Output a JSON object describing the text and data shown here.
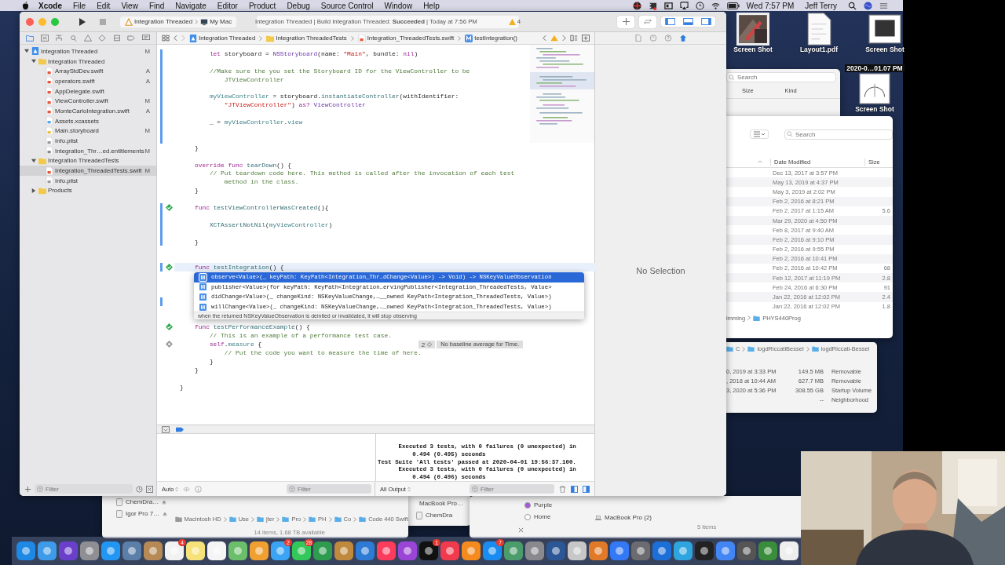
{
  "menubar": {
    "app": "Xcode",
    "menus": [
      "File",
      "Edit",
      "View",
      "Find",
      "Navigate",
      "Editor",
      "Product",
      "Debug",
      "Source Control",
      "Window",
      "Help"
    ],
    "clock": "Wed 7:57 PM",
    "user": "Jeff Terry"
  },
  "desktop_icons": [
    {
      "label": "Screen Shot"
    },
    {
      "label": "Layout1.pdf",
      "kind": "document"
    },
    {
      "label": "Screen Shot",
      "kind": "window"
    }
  ],
  "desktop_icon_extra": {
    "label": "Screen Shot",
    "sublabel": "2020-0…01.07 PM"
  },
  "finder_a": {
    "search_placeholder": "Search",
    "columns": [
      "Size",
      "Kind"
    ]
  },
  "finder_b": {
    "search_placeholder": "Search",
    "columns": [
      "Date Modified",
      "Size"
    ],
    "rows": [
      {
        "date": "Dec 13, 2017 at 3:57 PM"
      },
      {
        "date": "May 13, 2019 at 4:37 PM"
      },
      {
        "date": "May 3, 2019 at 2:02 PM"
      },
      {
        "date": "Feb 2, 2016 at 8:21 PM"
      },
      {
        "date": "Feb 2, 2017 at 1:15 AM",
        "size": "5.6"
      },
      {
        "date": "Mar 29, 2020 at 4:50 PM"
      },
      {
        "date": "Feb 8, 2017 at 9:40 AM"
      },
      {
        "date": "Feb 2, 2016 at 9:10 PM"
      },
      {
        "date": "Feb 2, 2016 at 9:55 PM"
      },
      {
        "date": "Feb 2, 2016 at 10:41 PM"
      },
      {
        "date": "Feb 2, 2016 at 10:42 PM",
        "size": "68"
      },
      {
        "date": "Feb 12, 2017 at 11:19 PM",
        "size": "2.8"
      },
      {
        "date": "Feb 24, 2016 at 6:30 PM",
        "size": "91"
      },
      {
        "date": "Jan 22, 2016 at 12:02 PM",
        "size": "2.4"
      },
      {
        "date": "Jan 22, 2016 at 12:02 PM",
        "size": "1.8"
      }
    ],
    "path": [
      "imming",
      "PHYS440Prog"
    ]
  },
  "finder_c": {
    "path": [
      "C",
      "logdRiccatiBessel",
      "logdRiccati-Bessel"
    ],
    "rows": [
      {
        "date": "0, 2019 at 3:33 PM",
        "size": "149.5 MB",
        "kind": "Removable"
      },
      {
        "date": ", 2018 at 10:44 AM",
        "size": "627.7 MB",
        "kind": "Removable"
      },
      {
        "date": "3, 2020 at 5:36 PM",
        "size": "308.55 GB",
        "kind": "Startup Volume"
      },
      {
        "size": "--",
        "kind": "Neighborhood"
      }
    ]
  },
  "finder_d": {
    "sidebar": [
      "ChemDra…",
      "Igor Pro 7…"
    ],
    "path": [
      "Macintosh HD",
      "Use",
      "jter",
      "Pro",
      "PH",
      "Co",
      "Code 440 Swift"
    ],
    "status": "14 items, 1.68 TB available"
  },
  "finder_e": {
    "items": [
      "MacBook Pro…",
      "ChemDra"
    ]
  },
  "finder_f": {
    "tags": [
      {
        "label": "Purple",
        "color": "#a25ddc"
      },
      {
        "label": "Home",
        "color": "#ffffff"
      }
    ],
    "location": "MacBook Pro (2)",
    "status": "5 items"
  },
  "xcode": {
    "toolbar": {
      "scheme": "Integration Threaded",
      "destination": "My Mac",
      "status": "Integration Threaded | Build Integration Threaded: **Succeeded** | Today at 7:56 PM",
      "warnings": "4",
      "panels": [
        {
          "selected": true
        },
        {
          "selected": true
        },
        {
          "selected": true
        }
      ]
    },
    "navigator": {
      "filter_placeholder": "Filter",
      "items": [
        {
          "label": "Integration Threaded",
          "kind": "project",
          "status": "M",
          "selected": false,
          "expanded": true,
          "children": [
            {
              "label": "Integration Threaded",
              "kind": "folder",
              "selected": false,
              "expanded": true,
              "children": [
                {
                  "label": "ArrayStdDev.swift",
                  "kind": "swift",
                  "status": "A",
                  "selected": false
                },
                {
                  "label": "operators.swift",
                  "kind": "swift",
                  "status": "A",
                  "selected": false
                },
                {
                  "label": "AppDelegate.swift",
                  "kind": "swift",
                  "selected": false
                },
                {
                  "label": "ViewController.swift",
                  "kind": "swift",
                  "status": "M",
                  "selected": false
                },
                {
                  "label": "MonteCarloIntegration.swift",
                  "kind": "swift",
                  "status": "A",
                  "selected": false
                },
                {
                  "label": "Assets.xcassets",
                  "kind": "assets",
                  "selected": false
                },
                {
                  "label": "Main.storyboard",
                  "kind": "storyboard",
                  "status": "M",
                  "selected": false
                },
                {
                  "label": "Info.plist",
                  "kind": "plist",
                  "selected": false
                },
                {
                  "label": "Integration_Thr…ed.entitlements",
                  "kind": "entitlements",
                  "status": "M",
                  "selected": false
                }
              ]
            },
            {
              "label": "Integration ThreadedTests",
              "kind": "folder",
              "selected": false,
              "expanded": true,
              "children": [
                {
                  "label": "Integration_ThreadedTests.swift",
                  "kind": "swift",
                  "status": "M",
                  "selected": true
                },
                {
                  "label": "Info.plist",
                  "kind": "plist",
                  "selected": false
                }
              ]
            },
            {
              "label": "Products",
              "kind": "folder",
              "selected": false,
              "expanded": false
            }
          ]
        }
      ]
    },
    "jump_bar": {
      "crumbs": [
        {
          "label": "Integration Threaded",
          "kind": "project"
        },
        {
          "label": "Integration ThreadedTests",
          "kind": "folder"
        },
        {
          "label": "Integration_ThreadedTests.swift",
          "kind": "swift"
        },
        {
          "label": "testIntegration()",
          "kind": "method"
        }
      ]
    },
    "code_lines": [
      {
        "changed": true,
        "current": false,
        "tokens": [
          {
            "kind": "kw",
            "text": "        let"
          },
          {
            "kind": "plain",
            "text": " storyboard = "
          },
          {
            "kind": "type",
            "text": "NSStoryboard"
          },
          {
            "kind": "plain",
            "text": "(name: "
          },
          {
            "kind": "str",
            "text": "\"Main\""
          },
          {
            "kind": "plain",
            "text": ", bundle: "
          },
          {
            "kind": "kw",
            "text": "nil"
          },
          {
            "kind": "plain",
            "text": ")"
          }
        ]
      },
      {
        "changed": true,
        "current": false
      },
      {
        "changed": true,
        "current": false,
        "tokens": [
          {
            "kind": "cm",
            "text": "        //Make sure the you set the Storyboard ID for the ViewController to be"
          }
        ]
      },
      {
        "changed": true,
        "current": false,
        "tokens": [
          {
            "kind": "cm",
            "text": "            JTViewController"
          }
        ]
      },
      {
        "changed": true,
        "current": false
      },
      {
        "changed": true,
        "current": false,
        "tokens": [
          {
            "kind": "id",
            "text": "        myViewController"
          },
          {
            "kind": "plain",
            "text": " = storyboard."
          },
          {
            "kind": "fn",
            "text": "instantiateController"
          },
          {
            "kind": "plain",
            "text": "(withIdentifier:"
          }
        ]
      },
      {
        "changed": true,
        "current": false,
        "tokens": [
          {
            "kind": "str",
            "text": "            \"JTViewController\""
          },
          {
            "kind": "plain",
            "text": ") "
          },
          {
            "kind": "kw",
            "text": "as?"
          },
          {
            "kind": "type",
            "text": " ViewController"
          }
        ]
      },
      {
        "changed": true,
        "current": false
      },
      {
        "changed": true,
        "current": false,
        "tokens": [
          {
            "kind": "plain",
            "text": "        _ = "
          },
          {
            "kind": "id",
            "text": "myViewController"
          },
          {
            "kind": "plain",
            "text": "."
          },
          {
            "kind": "id",
            "text": "view"
          }
        ]
      },
      {
        "changed": true,
        "current": false
      },
      {
        "changed": true,
        "current": false
      },
      {
        "changed": false,
        "current": false,
        "tokens": [
          {
            "kind": "plain",
            "text": "    }"
          }
        ]
      },
      {
        "changed": false,
        "current": false
      },
      {
        "changed": false,
        "current": false,
        "tokens": [
          {
            "kind": "kw",
            "text": "    override"
          },
          {
            "kind": "kw",
            "text": " func"
          },
          {
            "kind": "fn",
            "text": " tearDown"
          },
          {
            "kind": "plain",
            "text": "() {"
          }
        ]
      },
      {
        "changed": false,
        "current": false,
        "tokens": [
          {
            "kind": "cm",
            "text": "        // Put teardown code here. This method is called after the invocation of each test"
          }
        ]
      },
      {
        "changed": false,
        "current": false,
        "tokens": [
          {
            "kind": "cm",
            "text": "            method in the class."
          }
        ]
      },
      {
        "changed": false,
        "current": false,
        "tokens": [
          {
            "kind": "plain",
            "text": "    }"
          }
        ]
      },
      {
        "changed": false,
        "current": false
      },
      {
        "changed": true,
        "current": false,
        "kind": "passed",
        "tokens": [
          {
            "kind": "kw",
            "text": "    func"
          },
          {
            "kind": "fn",
            "text": " testViewControllerWasCreated"
          },
          {
            "kind": "plain",
            "text": "(){"
          }
        ]
      },
      {
        "changed": true,
        "current": false
      },
      {
        "changed": true,
        "current": false,
        "tokens": [
          {
            "kind": "fn",
            "text": "        XCTAssertNotNil"
          },
          {
            "kind": "plain",
            "text": "("
          },
          {
            "kind": "id",
            "text": "myViewController"
          },
          {
            "kind": "plain",
            "text": ")"
          }
        ]
      },
      {
        "changed": true,
        "current": false
      },
      {
        "changed": true,
        "current": false,
        "tokens": [
          {
            "kind": "plain",
            "text": "    }"
          }
        ]
      },
      {
        "changed": false,
        "current": false
      },
      {
        "changed": false,
        "current": false
      },
      {
        "changed": true,
        "current": true,
        "kind": "passed",
        "tokens": [
          {
            "kind": "kw",
            "text": "    func"
          },
          {
            "kind": "fn",
            "text": " testIntegration"
          },
          {
            "kind": "plain",
            "text": "() {"
          }
        ]
      },
      {
        "changed": false,
        "current": false
      },
      {
        "changed": false,
        "current": false
      },
      {
        "changed": false,
        "current": false
      },
      {
        "changed": true,
        "current": false
      },
      {
        "changed": false,
        "current": false
      },
      {
        "changed": false,
        "current": false
      },
      {
        "changed": false,
        "current": false,
        "kind": "passed",
        "tokens": [
          {
            "kind": "kw",
            "text": "    func"
          },
          {
            "kind": "fn",
            "text": " testPerformanceExample"
          },
          {
            "kind": "plain",
            "text": "() {"
          }
        ]
      },
      {
        "changed": false,
        "current": false,
        "tokens": [
          {
            "kind": "cm",
            "text": "        // This is an example of a performance test case."
          }
        ]
      },
      {
        "changed": false,
        "current": false,
        "kind": "untested",
        "tokens": [
          {
            "kind": "kw",
            "text": "        self"
          },
          {
            "kind": "plain",
            "text": "."
          },
          {
            "kind": "id",
            "text": "measure"
          },
          {
            "kind": "plain",
            "text": " {"
          }
        ]
      },
      {
        "changed": false,
        "current": false,
        "tokens": [
          {
            "kind": "cm",
            "text": "            // Put the code you want to measure the time of here."
          }
        ]
      },
      {
        "changed": false,
        "current": false,
        "tokens": [
          {
            "kind": "plain",
            "text": "        }"
          }
        ]
      },
      {
        "changed": false,
        "current": false,
        "tokens": [
          {
            "kind": "plain",
            "text": "    }"
          }
        ]
      },
      {
        "changed": false,
        "current": false
      },
      {
        "changed": false,
        "current": false,
        "tokens": [
          {
            "kind": "plain",
            "text": "}"
          }
        ]
      }
    ],
    "completion": {
      "items": [
        {
          "badge": "M",
          "text": "observe<Value>(_ keyPath: KeyPath<Integration_Thr…dChange<Value>) -> Void) -> NSKeyValueObservation",
          "selected": true
        },
        {
          "badge": "M",
          "text": "publisher<Value>(for keyPath: KeyPath<Integration…ervingPublisher<Integration_ThreadedTests, Value>",
          "selected": false
        },
        {
          "badge": "M",
          "text": "didChange<Value>(_ changeKind: NSKeyValueChange,…__owned KeyPath<Integration_ThreadedTests, Value>)",
          "selected": false
        },
        {
          "badge": "M",
          "text": "willChange<Value>(_ changeKind: NSKeyValueChange,…_owned KeyPath<Integration_ThreadedTests, Value>)",
          "selected": false
        }
      ],
      "description": "when the returned NSKeyValueObservation is deinited or invalidated, it will stop observing"
    },
    "annotation": {
      "count": "2",
      "text": "No baseline average for Time."
    },
    "inspector": {
      "empty_text": "No Selection"
    },
    "debug": {
      "variables_scope": "Auto",
      "output_scope": "All Output",
      "variables_filter_placeholder": "Filter",
      "output_filter_placeholder": "Filter",
      "console": [
        "      Executed 3 tests, with 0 failures (0 unexpected) in",
        "          0.494 (0.495) seconds",
        "Test Suite 'All tests' passed at 2020-04-01 19:56:37.100.",
        "      Executed 3 tests, with 0 failures (0 unexpected) in",
        "          0.494 (0.496) seconds"
      ]
    }
  },
  "dock": [
    {
      "color": "#1e88e5"
    },
    {
      "color": "#3d9be9"
    },
    {
      "color": "#6a3fc9"
    },
    {
      "color": "#8e8e93"
    },
    {
      "color": "#2196f3"
    },
    {
      "color": "#5b7fa8"
    },
    {
      "color": "#b78a55"
    },
    {
      "color": "#f2f2f2",
      "badge": "4"
    },
    {
      "color": "#f7e27a"
    },
    {
      "color": "#f5f5f5"
    },
    {
      "color": "#6cbf6a"
    },
    {
      "color": "#f0a030"
    },
    {
      "color": "#3ba4f5",
      "badge": "2"
    },
    {
      "color": "#34c759",
      "badge": "28"
    },
    {
      "color": "#2e9b4e"
    },
    {
      "color": "#c08a3e"
    },
    {
      "color": "#2e7bd6"
    },
    {
      "color": "#fc3c5c"
    },
    {
      "color": "#9b45d6"
    },
    {
      "color": "#111111",
      "badge": "1"
    },
    {
      "color": "#f23a4e"
    },
    {
      "color": "#f58a1f"
    },
    {
      "color": "#1a8cf0",
      "badge": "7"
    },
    {
      "color": "#4a9d6a"
    },
    {
      "color": "#8a8a8e"
    },
    {
      "color": "#2b5797"
    },
    {
      "color": "#c7c7c7"
    },
    {
      "color": "#e07a28"
    },
    {
      "color": "#3478f6"
    },
    {
      "color": "#6b6b70"
    },
    {
      "color": "#1d6fd8"
    },
    {
      "color": "#2fa5e0"
    },
    {
      "color": "#222222"
    },
    {
      "color": "#4285f4"
    },
    {
      "color": "#555555"
    },
    {
      "color": "#3a8d3a"
    },
    {
      "color": "#eeeeee"
    }
  ]
}
